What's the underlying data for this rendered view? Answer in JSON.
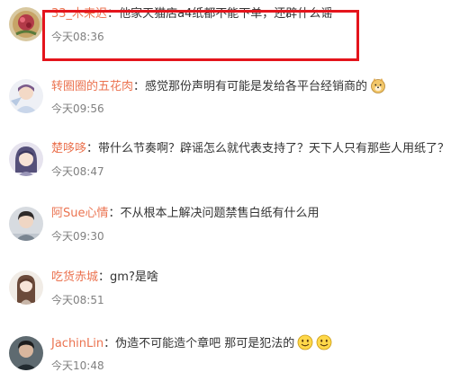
{
  "comments": [
    {
      "username": "33_木来迟",
      "sep": "：",
      "content": "他家天猫店a4纸都不能下单，还辟什么谣",
      "time": "今天08:36"
    },
    {
      "username": "转圈圈的五花肉",
      "sep": "：",
      "content": "感觉那份声明有可能是发给各平台经销商的",
      "time": "今天09:56"
    },
    {
      "username": "楚哆哆",
      "sep": "：",
      "content": "带什么节奏啊？辟谣怎么就代表支持了？天下人只有那些人用纸了？",
      "time": "今天08:47"
    },
    {
      "username": "阿Sue心情",
      "sep": "：",
      "content": "不从根本上解决问题禁售白纸有什么用",
      "time": "今天09:30"
    },
    {
      "username": "吃货赤城",
      "sep": "：",
      "content": "gm?是啥",
      "time": "今天08:51"
    },
    {
      "username": "JachinLin",
      "sep": "：",
      "content": "伪造不可能造个章吧 那可是犯法的",
      "time": "今天10:48"
    }
  ],
  "colors": {
    "username": "#eb7350",
    "text": "#333333",
    "time": "#808080",
    "highlight": "#e4141c"
  }
}
